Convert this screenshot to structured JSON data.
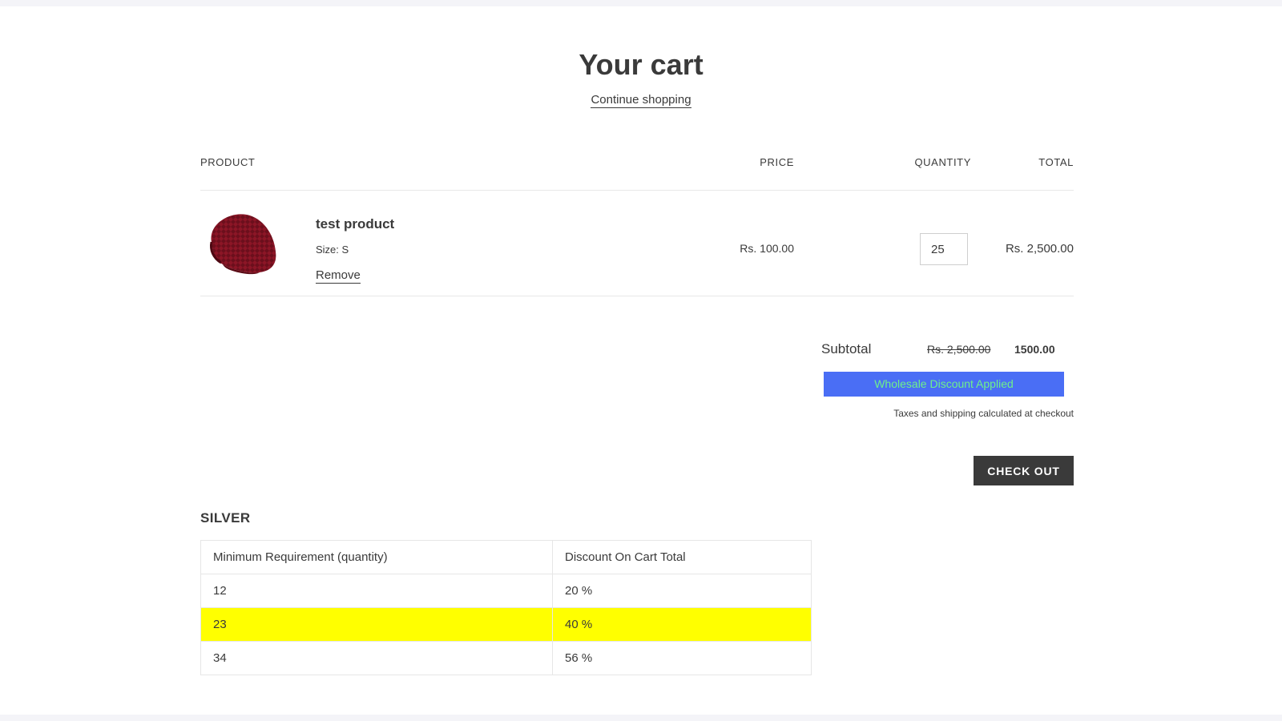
{
  "header": {
    "title": "Your cart",
    "continue_label": "Continue shopping"
  },
  "table_headers": {
    "product": "PRODUCT",
    "price": "PRICE",
    "quantity": "QUANTITY",
    "total": "TOTAL"
  },
  "line_item": {
    "name": "test product",
    "size": "Size: S",
    "remove_label": "Remove",
    "price": "Rs. 100.00",
    "quantity": "25",
    "total": "Rs. 2,500.00",
    "image": "red knit beanie"
  },
  "summary": {
    "subtotal_label": "Subtotal",
    "original_total": "Rs. 2,500.00",
    "discounted_total": "1500.00",
    "discount_banner": "Wholesale Discount Applied",
    "tax_note": "Taxes and shipping calculated at checkout",
    "checkout_label": "CHECK OUT"
  },
  "tiers": {
    "title": "SILVER",
    "headers": [
      "Minimum Requirement (quantity)",
      "Discount On Cart Total"
    ],
    "rows": [
      {
        "min": "12",
        "discount": "20 %"
      },
      {
        "min": "23",
        "discount": "40 %"
      },
      {
        "min": "34",
        "discount": "56 %"
      }
    ],
    "active_row_color": "#ffff00"
  },
  "colors": {
    "text": "#3a3a3a",
    "banner_bg": "#4a6ef5",
    "banner_text": "#6ef08a",
    "checkout_bg": "#3a3a3a"
  }
}
